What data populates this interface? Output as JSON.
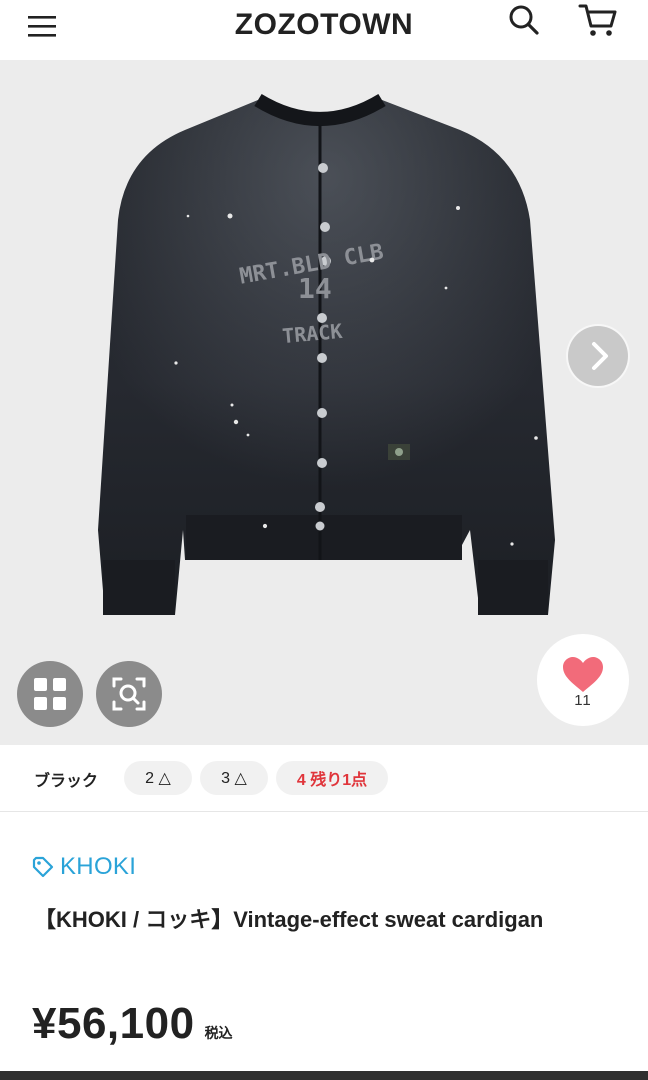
{
  "header": {
    "logo": "ZOZOTOWN",
    "icons": {
      "menu": "hamburger-menu-icon",
      "search": "search-icon",
      "cart": "cart-icon"
    }
  },
  "gallery": {
    "next_icon": "chevron-right-icon",
    "thumbnails_icon": "grid-icon",
    "zoom_icon": "zoom-scan-icon",
    "favorite_icon": "heart-icon",
    "favorite_count": "11",
    "print_text": {
      "line1": "MRT.BLD CLB",
      "number": "14",
      "line2": "TRACK"
    }
  },
  "variant": {
    "color": "ブラック",
    "sizes": [
      {
        "label": "2 △"
      },
      {
        "label": "3 △"
      },
      {
        "label": "4 残り1点"
      }
    ]
  },
  "product": {
    "brand": "KHOKI",
    "brand_icon": "tag-icon",
    "title": "【KHOKI / コッキ】Vintage-effect sweat cardigan",
    "price": "¥56,100",
    "tax_label": "税込"
  },
  "colors": {
    "accent": "#2aa3d8",
    "alert": "#e0353b",
    "favorite": "#f26b7a",
    "garment": "#2a2d33"
  }
}
